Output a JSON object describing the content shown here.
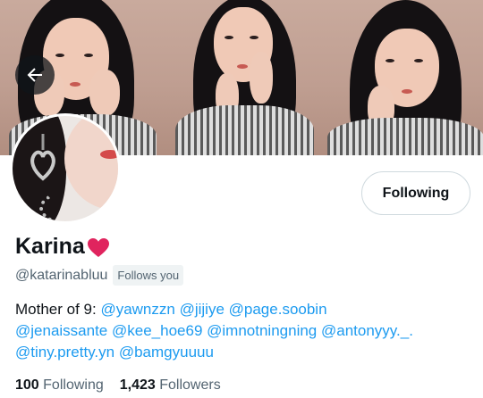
{
  "header": {
    "back_icon": "arrow-left-icon"
  },
  "profile": {
    "name": "Karina",
    "name_emoji": "red-heart-icon",
    "handle": "@katarinabluu",
    "follows_you_badge": "Follows you",
    "follow_button_label": "Following"
  },
  "bio": {
    "prefix": "Mother of 9: ",
    "line1_mentions": [
      "@yawnzzn",
      "@jijiye",
      "@page.soobin"
    ],
    "line2_mentions": [
      "@jenaissante",
      "@kee_hoe69",
      "@imnotningning",
      "@antonyyy._."
    ],
    "line3_mentions": [
      "@tiny.pretty.yn",
      "@bamgyuuuu"
    ]
  },
  "stats": {
    "following_count": "100",
    "following_label": "Following",
    "followers_count": "1,423",
    "followers_label": "Followers"
  },
  "colors": {
    "link": "#1d9bf0",
    "secondary_text": "#536471",
    "heart": "#e0245e"
  }
}
